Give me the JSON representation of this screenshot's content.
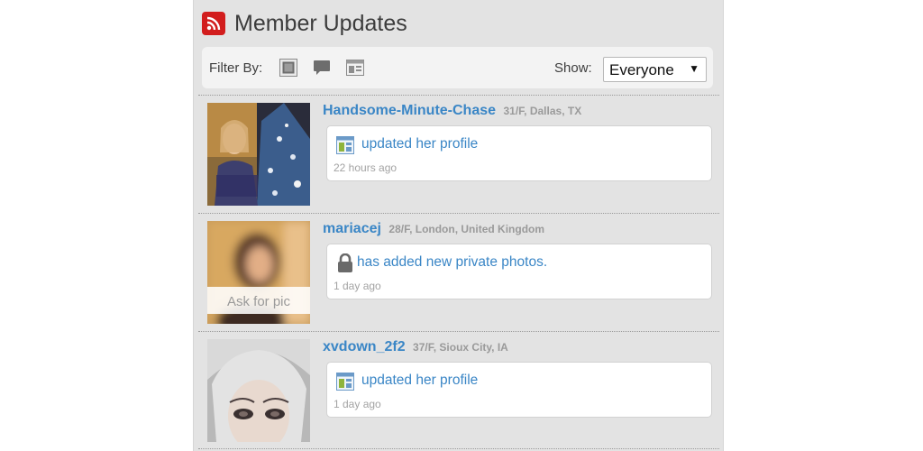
{
  "header": {
    "title": "Member Updates",
    "icon": "rss-feed-icon",
    "icon_color": "#d21d1d"
  },
  "filter": {
    "label": "Filter By:",
    "buttons": [
      "photo-filter-icon",
      "comment-filter-icon",
      "profile-filter-icon"
    ],
    "show_label": "Show:",
    "show_value": "Everyone",
    "show_arrow": "▼"
  },
  "updates": [
    {
      "name": "Handsome-Minute-Chase",
      "meta": "31/F, Dallas, TX",
      "icon": "profile-update-icon",
      "action": "updated her profile",
      "time": "22 hours ago"
    },
    {
      "name": "mariacej",
      "meta": "28/F, London, United Kingdom",
      "icon": "lock-icon",
      "action": "has added new private photos.",
      "time": "1 day ago",
      "avatar_overlay": "Ask for pic"
    },
    {
      "name": "xvdown_2f2",
      "meta": "37/F, Sioux City, IA",
      "icon": "profile-update-icon",
      "action": "updated her profile",
      "time": "1 day ago"
    }
  ],
  "colors": {
    "link": "#3a86c6",
    "panel_bg": "#e3e3e3",
    "meta_gray": "#9a9a9a"
  }
}
